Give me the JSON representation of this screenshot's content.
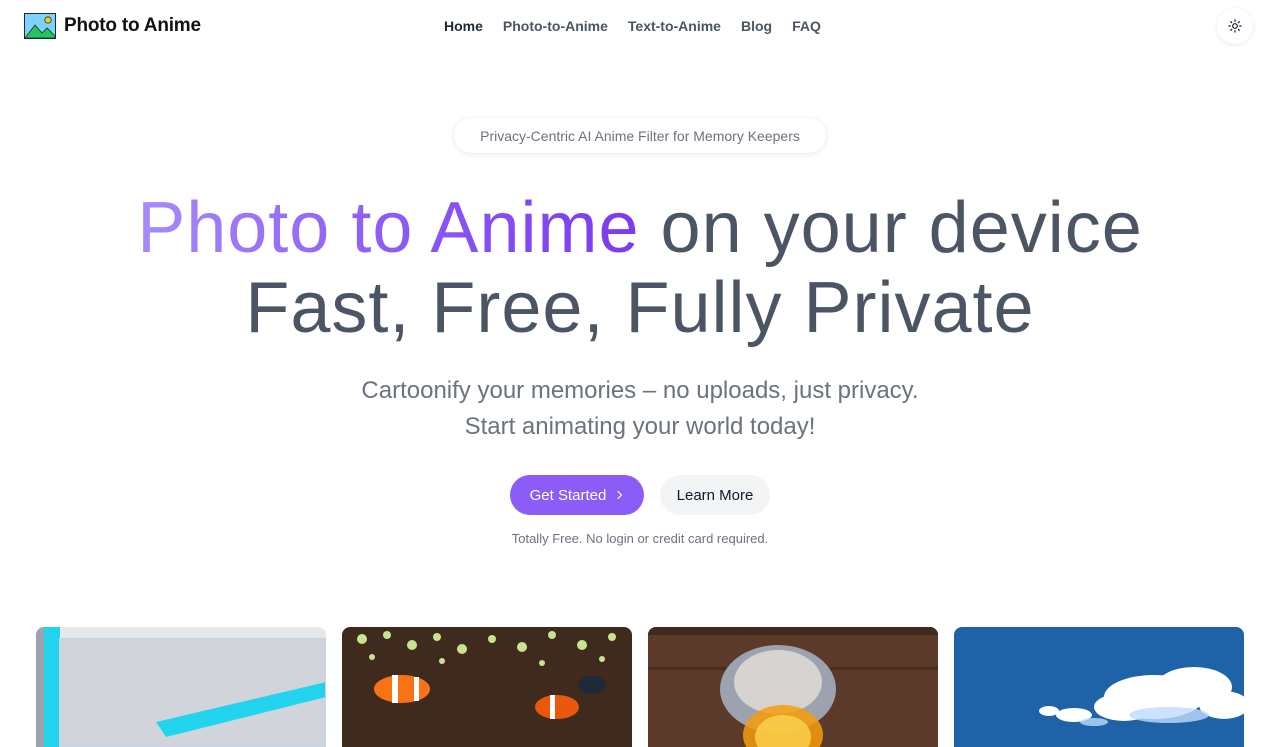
{
  "header": {
    "logo_text": "Photo to Anime",
    "nav": [
      {
        "label": "Home",
        "active": true
      },
      {
        "label": "Photo-to-Anime",
        "active": false
      },
      {
        "label": "Text-to-Anime",
        "active": false
      },
      {
        "label": "Blog",
        "active": false
      },
      {
        "label": "FAQ",
        "active": false
      }
    ],
    "theme_toggle_icon": "sun-icon"
  },
  "hero": {
    "badge": "Privacy-Centric AI Anime Filter for Memory Keepers",
    "title_highlight": "Photo to Anime",
    "title_rest": " on your device",
    "title_line2": "Fast, Free, Fully Private",
    "subtitle_line1": "Cartoonify your memories – no uploads, just privacy.",
    "subtitle_line2": "Start animating your world today!",
    "primary_button": "Get Started",
    "secondary_button": "Learn More",
    "note": "Totally Free. No login or credit card required."
  },
  "gallery": {
    "images": [
      "anime-window-image",
      "anime-clownfish-image",
      "anime-portrait-image",
      "anime-clouds-image"
    ]
  },
  "colors": {
    "accent": "#8b5cf6",
    "title_gray": "#4b5563",
    "text_muted": "#6b7280"
  }
}
